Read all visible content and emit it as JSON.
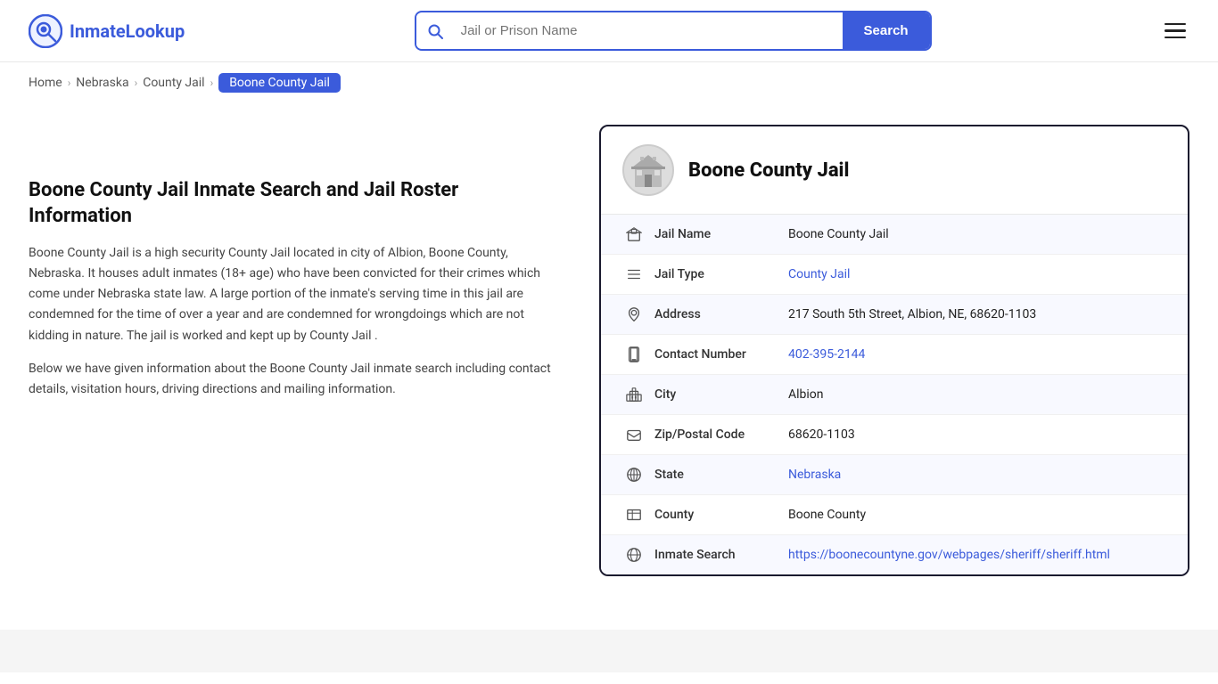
{
  "header": {
    "logo_text_main": "Inmate",
    "logo_text_accent": "Lookup",
    "search_placeholder": "Jail or Prison Name",
    "search_button_label": "Search"
  },
  "breadcrumb": {
    "home": "Home",
    "state": "Nebraska",
    "type": "County Jail",
    "current": "Boone County Jail"
  },
  "left": {
    "heading": "Boone County Jail Inmate Search and Jail Roster Information",
    "paragraph1": "Boone County Jail is a high security County Jail located in city of Albion, Boone County, Nebraska. It houses adult inmates (18+ age) who have been convicted for their crimes which come under Nebraska state law. A large portion of the inmate's serving time in this jail are condemned for the time of over a year and are condemned for wrongdoings which are not kidding in nature. The jail is worked and kept up by County Jail .",
    "paragraph2": "Below we have given information about the Boone County Jail inmate search including contact details, visitation hours, driving directions and mailing information."
  },
  "card": {
    "title": "Boone County Jail",
    "rows": [
      {
        "icon": "building-icon",
        "label": "Jail Name",
        "value": "Boone County Jail",
        "link": null
      },
      {
        "icon": "list-icon",
        "label": "Jail Type",
        "value": "County Jail",
        "link": "county-jail"
      },
      {
        "icon": "location-icon",
        "label": "Address",
        "value": "217 South 5th Street, Albion, NE, 68620-1103",
        "link": null
      },
      {
        "icon": "phone-icon",
        "label": "Contact Number",
        "value": "402-395-2144",
        "link": "tel:402-395-2144"
      },
      {
        "icon": "city-icon",
        "label": "City",
        "value": "Albion",
        "link": null
      },
      {
        "icon": "zip-icon",
        "label": "Zip/Postal Code",
        "value": "68620-1103",
        "link": null
      },
      {
        "icon": "globe-icon",
        "label": "State",
        "value": "Nebraska",
        "link": "nebraska"
      },
      {
        "icon": "county-icon",
        "label": "County",
        "value": "Boone County",
        "link": null
      },
      {
        "icon": "search-link-icon",
        "label": "Inmate Search",
        "value": "https://boonecountyne.gov/webpages/sheriff/sheriff.html",
        "link": "https://boonecountyne.gov/webpages/sheriff/sheriff.html"
      }
    ]
  },
  "icons": {
    "building": "🏛",
    "list": "☰",
    "location": "📍",
    "phone": "📞",
    "city": "🏙",
    "zip": "✉",
    "globe": "🌐",
    "county": "🗺",
    "search-link": "🌐"
  }
}
